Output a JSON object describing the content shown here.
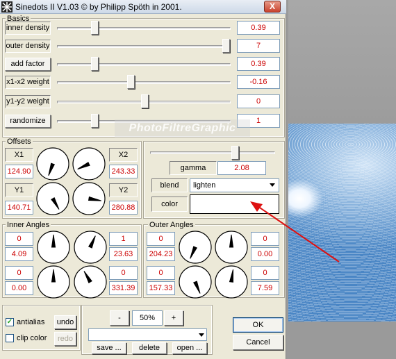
{
  "window": {
    "title": "Sinedots II V1.03 © by Philipp Spöth in 2001.",
    "close_label": "X"
  },
  "watermark": "PhotoFiltreGraphic",
  "basics": {
    "label": "Basics",
    "rows": [
      {
        "label": "inner density",
        "value": "0.39",
        "level": 0.21
      },
      {
        "label": "outer density",
        "value": "7",
        "level": 0.98
      },
      {
        "label": "add factor",
        "value": "0.39",
        "level": 0.21
      },
      {
        "label": "x1-x2 weight",
        "value": "-0.16",
        "level": 0.42
      },
      {
        "label": "y1-y2 weight",
        "value": "0",
        "level": 0.5
      },
      {
        "label": "randomize",
        "value": "1",
        "level": 0.21
      }
    ]
  },
  "offsets": {
    "label": "Offsets",
    "x1": {
      "label": "X1",
      "value": "124.90"
    },
    "x2": {
      "label": "X2",
      "value": "243.33"
    },
    "y1": {
      "label": "Y1",
      "value": "140.71"
    },
    "y2": {
      "label": "Y2",
      "value": "280.88"
    }
  },
  "render": {
    "gamma_label": "gamma",
    "gamma_value": "2.08",
    "gamma_level": 0.68,
    "blend_label": "blend",
    "blend_value": "lighten",
    "color_label": "color"
  },
  "inner_angles": {
    "label": "Inner Angles",
    "top": {
      "left_a": "0",
      "left_b": "4.09",
      "right_a": "1",
      "right_b": "23.63"
    },
    "bottom": {
      "left_a": "0",
      "left_b": "0.00",
      "right_a": "0",
      "right_b": "331.39"
    }
  },
  "outer_angles": {
    "label": "Outer Angles",
    "top": {
      "left_a": "0",
      "left_b": "204.23",
      "right_a": "0",
      "right_b": "0.00"
    },
    "bottom": {
      "left_a": "0",
      "left_b": "157.33",
      "right_a": "0",
      "right_b": "7.59"
    }
  },
  "options": {
    "antialias_label": "antialias",
    "antialias_checked": true,
    "clipcolor_label": "clip color",
    "clipcolor_checked": false,
    "undo_label": "undo",
    "redo_label": "redo"
  },
  "zoom": {
    "minus": "-",
    "value": "50%",
    "plus": "+"
  },
  "presets": {
    "save_label": "save ...",
    "delete_label": "delete",
    "open_label": "open ..."
  },
  "dialog": {
    "ok_label": "OK",
    "cancel_label": "Cancel"
  },
  "colors": {
    "value_text": "#cc0000",
    "arrow": "#dd1111",
    "window_bg": "#ece9d8"
  }
}
